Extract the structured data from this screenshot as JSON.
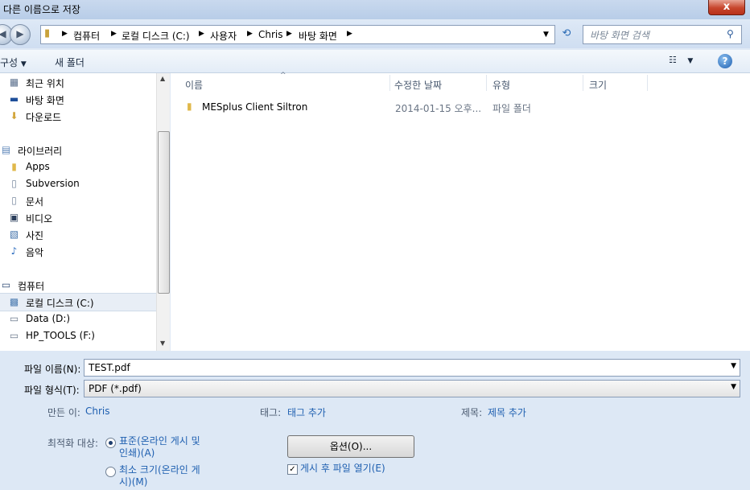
{
  "window": {
    "title": "다른 이름으로 저장",
    "close_label": "x"
  },
  "address": {
    "crumbs": [
      "컴퓨터",
      "로컬 디스크 (C:)",
      "사용자",
      "Chris",
      "바탕 화면"
    ],
    "search_placeholder": "바탕 화면 검색"
  },
  "toolbar": {
    "organize_label": "구성",
    "new_folder_label": "새 폴더",
    "help_label": "?"
  },
  "nav": {
    "items": [
      {
        "label": "최근 위치",
        "icon": "recent-places-icon"
      },
      {
        "label": "바탕 화면",
        "icon": "desktop-icon"
      },
      {
        "label": "다운로드",
        "icon": "downloads-icon"
      },
      {
        "label": "라이브러리",
        "icon": "library-icon"
      },
      {
        "label": "Apps",
        "icon": "folder-icon"
      },
      {
        "label": "Subversion",
        "icon": "document-icon"
      },
      {
        "label": "문서",
        "icon": "documents-icon"
      },
      {
        "label": "비디오",
        "icon": "video-icon"
      },
      {
        "label": "사진",
        "icon": "pictures-icon"
      },
      {
        "label": "음악",
        "icon": "music-icon"
      },
      {
        "label": "컴퓨터",
        "icon": "computer-icon"
      },
      {
        "label": "로컬 디스크 (C:)",
        "icon": "local-disk-icon"
      },
      {
        "label": "Data (D:)",
        "icon": "drive-icon"
      },
      {
        "label": "HP_TOOLS (F:)",
        "icon": "drive-icon"
      }
    ]
  },
  "filelist": {
    "columns": [
      "이름",
      "수정한 날짜",
      "유형",
      "크기"
    ],
    "rows": [
      {
        "name": "MESplus Client Siltron",
        "modified": "2014-01-15 오후...",
        "type": "파일 폴더",
        "size": ""
      }
    ]
  },
  "form": {
    "filename_label": "파일 이름(N):",
    "filename_value": "TEST.pdf",
    "filetype_label": "파일 형식(T):",
    "filetype_value": "PDF (*.pdf)",
    "author_label": "만든 이:",
    "author_value": "Chris",
    "tags_label": "태그:",
    "tags_value": "태그 추가",
    "title_label": "제목:",
    "title_value": "제목 추가",
    "optimize_label": "최적화 대상:",
    "opt_standard_line1": "표준(온라인 게시 및",
    "opt_standard_line2": "인쇄)(A)",
    "opt_min_line1": "최소 크기(온라인 게",
    "opt_min_line2": "시)(M)",
    "options_button": "옵션(O)...",
    "open_after_label": "게시 후 파일 열기(E)",
    "open_after_checked": true
  }
}
